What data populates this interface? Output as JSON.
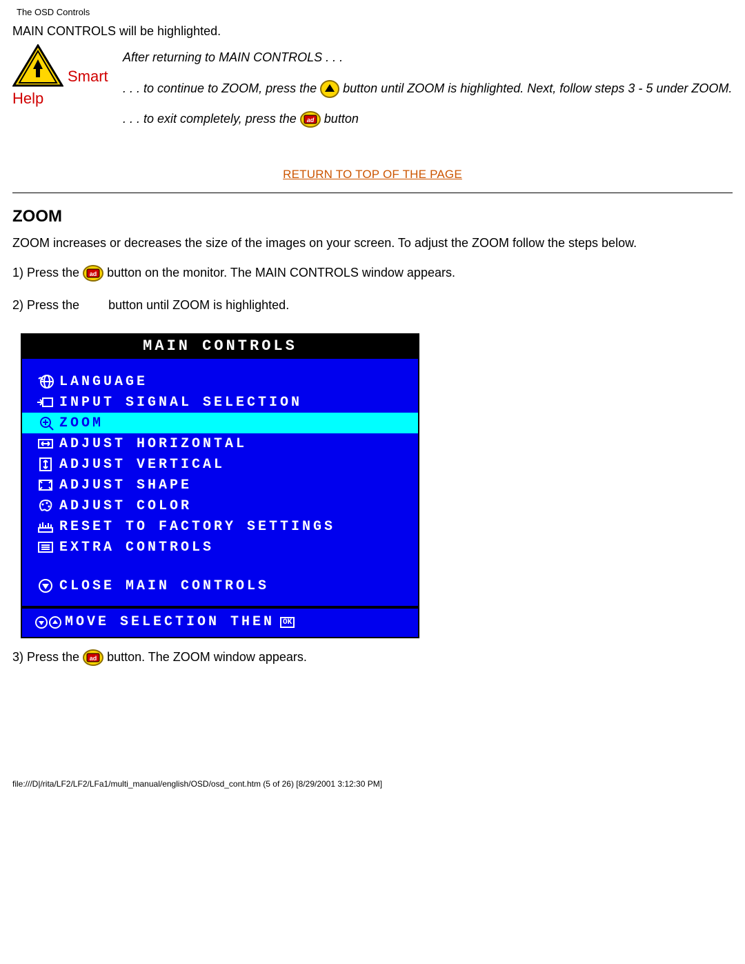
{
  "header_path": "The OSD Controls",
  "intro_line": "MAIN CONTROLS will be highlighted.",
  "smart_help": {
    "smart": "Smart",
    "help": "Help",
    "after_line": "After returning to MAIN CONTROLS . . .",
    "cont_part1": ". . . to continue to ZOOM, press the ",
    "cont_part2": " button until ZOOM is highlighted. Next, follow steps 3 - 5 under ZOOM.",
    "exit_part1": ". . . to exit completely, press the ",
    "exit_part2": " button"
  },
  "return_top": "RETURN TO TOP OF THE PAGE",
  "zoom_heading": "ZOOM",
  "zoom_intro": "ZOOM increases or decreases the size of the images on your screen. To adjust the ZOOM follow the steps below.",
  "step1_a": "1) Press the ",
  "step1_b": " button on the monitor. The MAIN CONTROLS window appears.",
  "step2_a": "2) Press the ",
  "step2_b": " button until ZOOM is highlighted.",
  "step3_a": "3) Press the ",
  "step3_b": " button. The ZOOM window appears.",
  "osd": {
    "title": "MAIN CONTROLS",
    "items": [
      {
        "label": "LANGUAGE",
        "icon": "globe"
      },
      {
        "label": "INPUT SIGNAL SELECTION",
        "icon": "input"
      },
      {
        "label": "ZOOM",
        "icon": "zoom",
        "selected": true
      },
      {
        "label": "ADJUST HORIZONTAL",
        "icon": "horiz"
      },
      {
        "label": "ADJUST VERTICAL",
        "icon": "vert"
      },
      {
        "label": "ADJUST SHAPE",
        "icon": "shape"
      },
      {
        "label": "ADJUST COLOR",
        "icon": "color"
      },
      {
        "label": "RESET TO FACTORY SETTINGS",
        "icon": "reset"
      },
      {
        "label": "EXTRA CONTROLS",
        "icon": "extra"
      }
    ],
    "close": "CLOSE MAIN CONTROLS",
    "footer": "MOVE SELECTION THEN",
    "ok": "OK"
  },
  "footer_path": "file:///D|/rita/LF2/LF2/LFa1/multi_manual/english/OSD/osd_cont.htm (5 of 26) [8/29/2001 3:12:30 PM]"
}
